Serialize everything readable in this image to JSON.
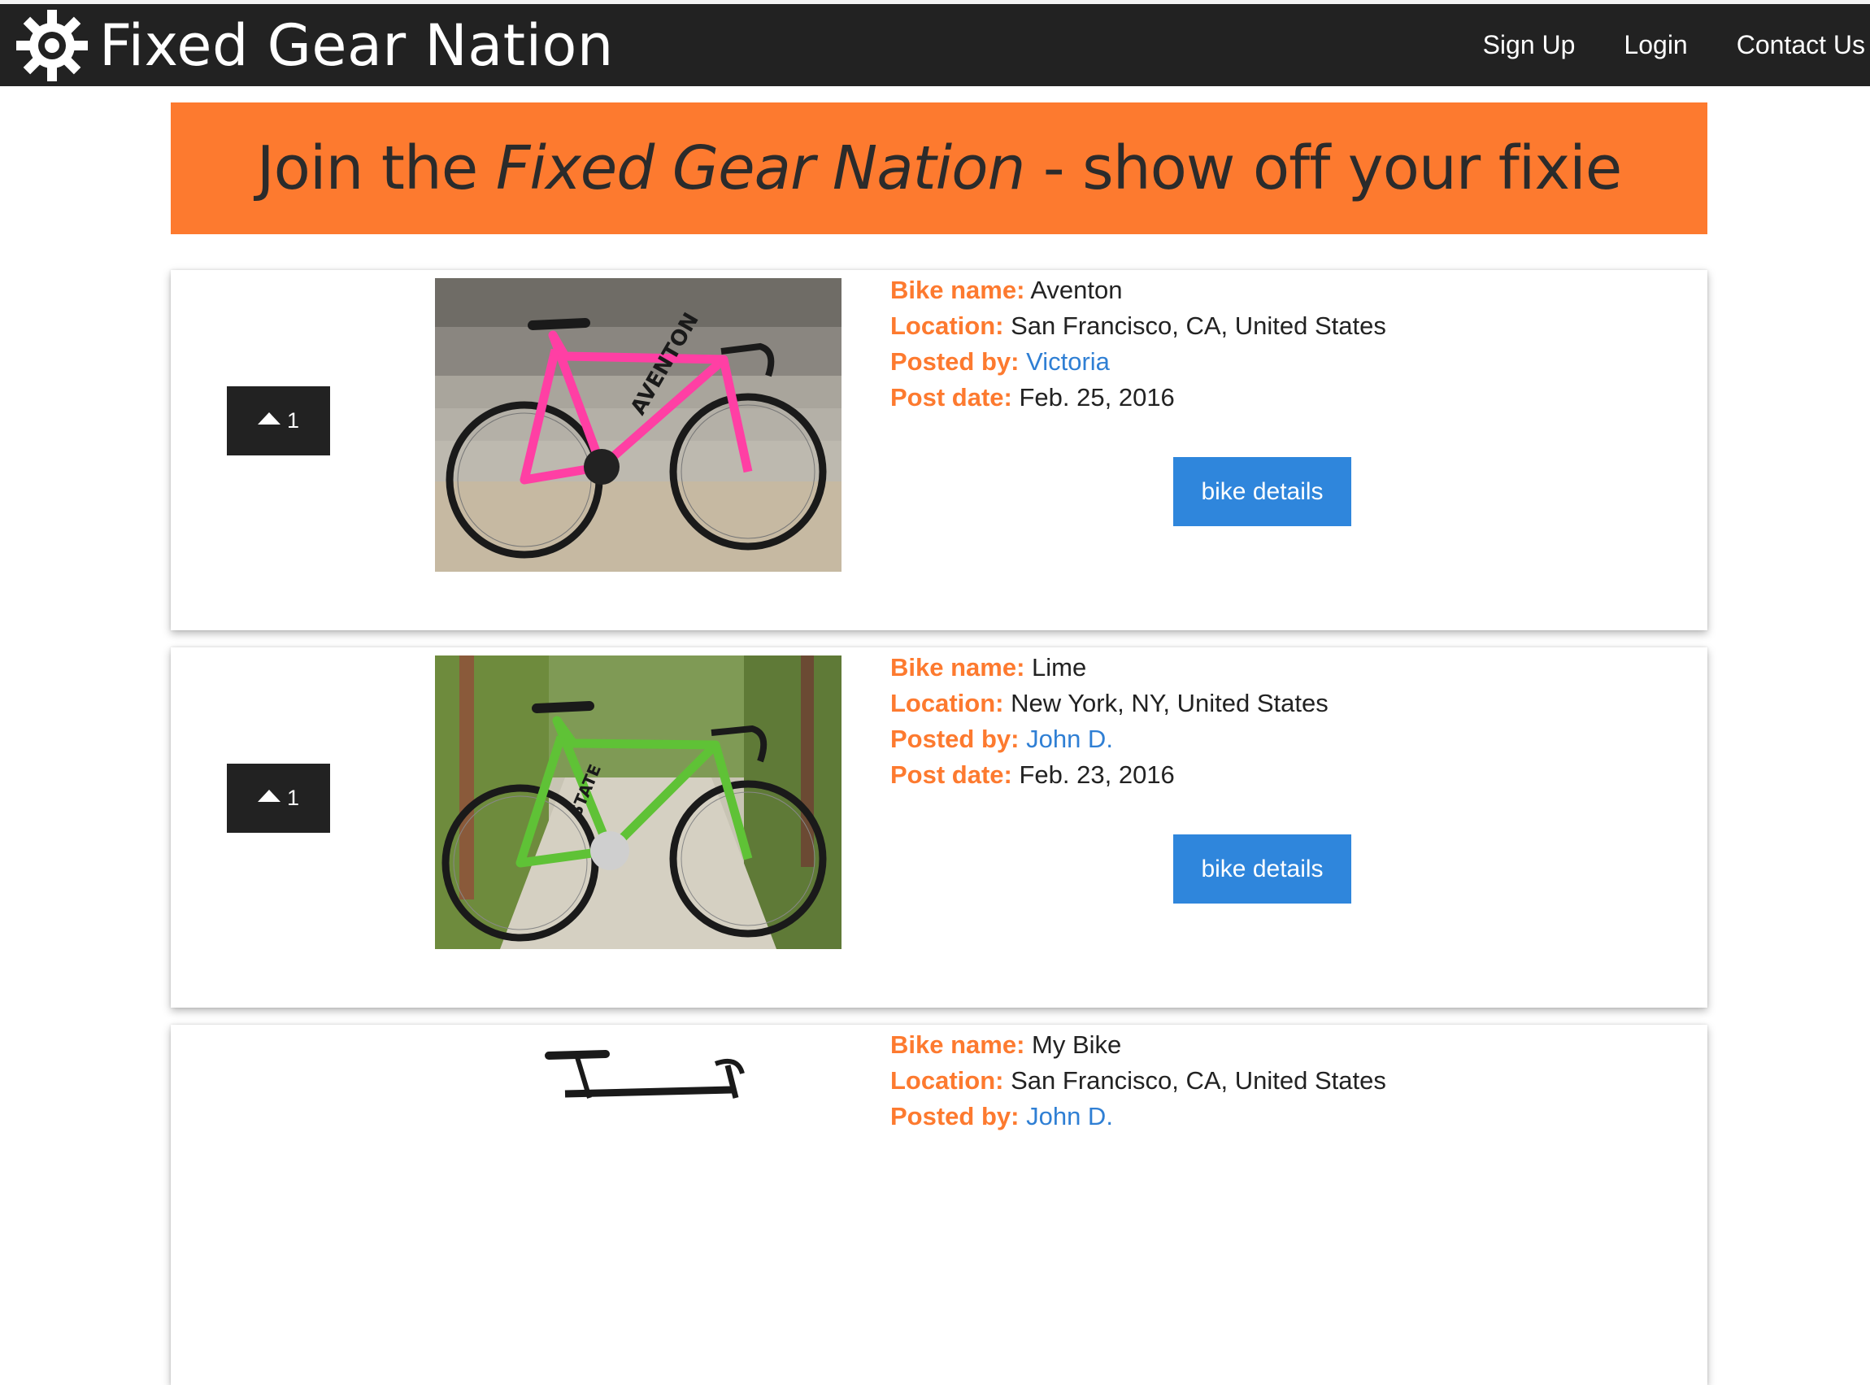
{
  "navbar": {
    "brand": "Fixed Gear Nation",
    "links": [
      "Sign Up",
      "Login",
      "Contact Us"
    ]
  },
  "hero": {
    "prefix": "Join the ",
    "emphasis": "Fixed Gear Nation",
    "suffix": " - show off your fixie"
  },
  "labels": {
    "bike_name": "Bike name:",
    "location": "Location:",
    "posted_by": "Posted by:",
    "post_date": "Post date:"
  },
  "posts": [
    {
      "votes": "1",
      "bike_name": "Aventon",
      "location": "San Francisco, CA, United States",
      "posted_by": "Victoria",
      "post_date": "Feb. 25, 2016",
      "button": "bike details",
      "frame_text": "AVENTON",
      "frame_color": "#ff3fa4"
    },
    {
      "votes": "1",
      "bike_name": "Lime",
      "location": "New York, NY, United States",
      "posted_by": "John D.",
      "post_date": "Feb. 23, 2016",
      "button": "bike details",
      "frame_text": "STATE",
      "frame_color": "#5fc236"
    },
    {
      "bike_name": "My Bike",
      "location": "San Francisco, CA, United States",
      "posted_by": "John D."
    }
  ],
  "colors": {
    "accent_orange": "#fd7a2f",
    "navbar": "#222222",
    "button_blue": "#2f86dc",
    "link_blue": "#2f7fd4"
  }
}
